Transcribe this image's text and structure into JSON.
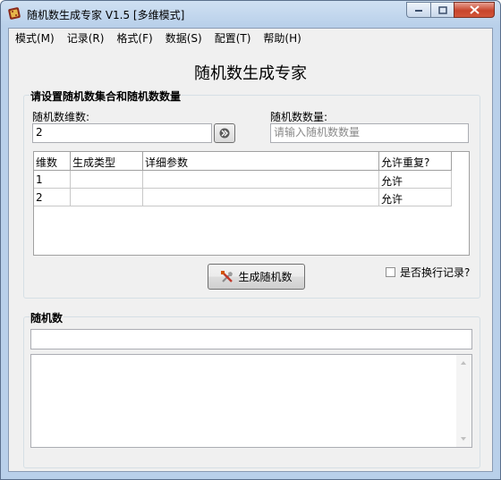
{
  "window": {
    "title": "随机数生成专家 V1.5 [多维模式]",
    "minimize_symbol": "–",
    "maximize_symbol": "□",
    "close_symbol": "✕"
  },
  "menu": {
    "items": [
      "模式(M)",
      "记录(R)",
      "格式(F)",
      "数据(S)",
      "配置(T)",
      "帮助(H)"
    ]
  },
  "heading": "随机数生成专家",
  "settings": {
    "group_label": "请设置随机数集合和随机数数量",
    "dimension_label": "随机数维数:",
    "dimension_value": "2",
    "count_label": "随机数数量:",
    "count_placeholder": "请输入随机数数量",
    "go_symbol": "»"
  },
  "table": {
    "headers": [
      "维数",
      "生成类型",
      "详细参数",
      "允许重复?"
    ],
    "rows": [
      [
        "1",
        "",
        "",
        "允许"
      ],
      [
        "2",
        "",
        "",
        "允许"
      ]
    ]
  },
  "generate_button": "生成随机数",
  "newline_checkbox": {
    "label": "是否换行记录?",
    "checked": false
  },
  "result": {
    "group_label": "随机数",
    "line_value": "",
    "area_value": ""
  },
  "colors": {
    "titlebar": "#b9d0ea",
    "close_button": "#c8452c",
    "client_bg": "#f0f0f0"
  }
}
